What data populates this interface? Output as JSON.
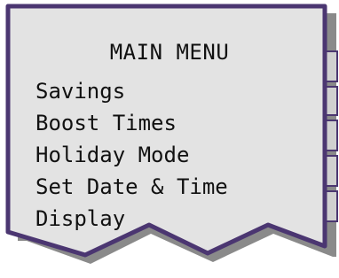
{
  "colors": {
    "panel_border": "#4b3671",
    "panel_fill": "#e3e3e3",
    "shadow": "#8a8a8a",
    "text": "#111111"
  },
  "menu": {
    "title": "MAIN MENU",
    "items": [
      {
        "label": "Savings"
      },
      {
        "label": "Boost Times"
      },
      {
        "label": "Holiday Mode"
      },
      {
        "label": "Set Date & Time"
      },
      {
        "label": "Display"
      }
    ]
  }
}
